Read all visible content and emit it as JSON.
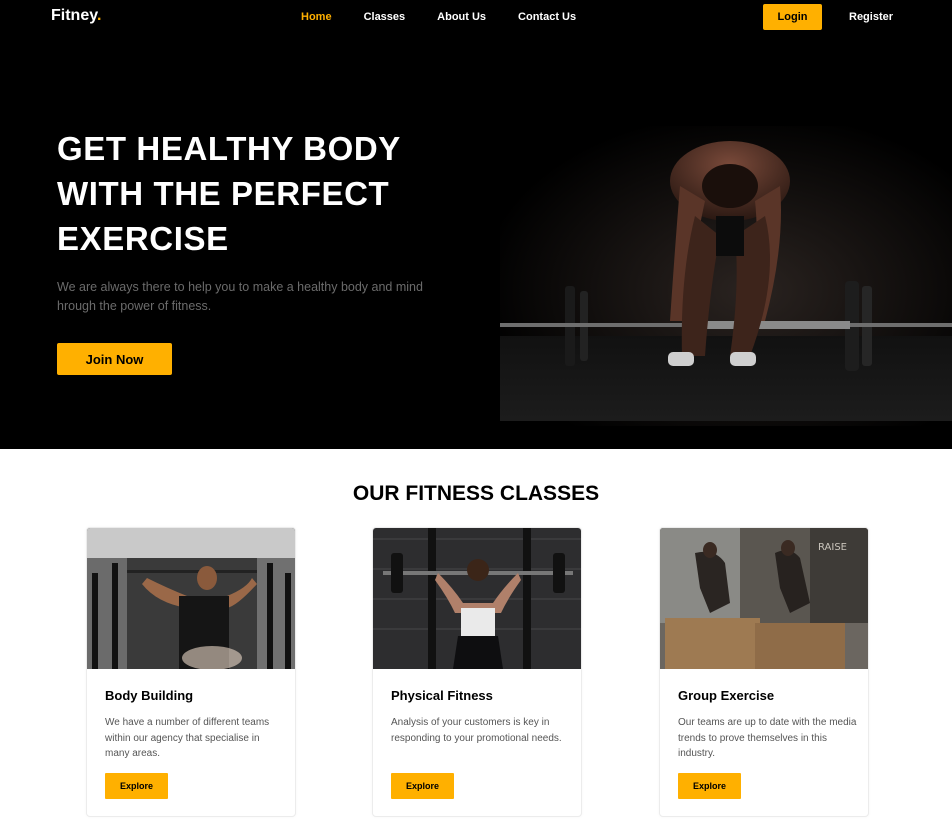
{
  "nav": {
    "logo": "Fitney",
    "logo_dot": ".",
    "items": [
      {
        "label": "Home",
        "active": true
      },
      {
        "label": "Classes",
        "active": false
      },
      {
        "label": "About Us",
        "active": false
      },
      {
        "label": "Contact Us",
        "active": false
      }
    ],
    "login_label": "Login",
    "register_label": "Register"
  },
  "hero": {
    "heading_line1": "GET HEALTHY BODY",
    "heading_line2": "WITH THE PERFECT",
    "heading_line3": "EXERCISE",
    "description": "We are always there to help you to make a healthy body and mind hrough the power of fitness.",
    "cta_label": "Join Now",
    "image_icon": "weightlifter-deadlift-photo"
  },
  "classes": {
    "title": "OUR FITNESS CLASSES",
    "cards": [
      {
        "title": "Body Building",
        "description": "We have a number of different teams within our agency that specialise in many areas.",
        "button": "Explore",
        "image_icon": "lat-pulldown-photo"
      },
      {
        "title": "Physical Fitness",
        "description": "Analysis of your customers is key in responding to your promotional needs.",
        "button": "Explore",
        "image_icon": "overhead-barbell-photo"
      },
      {
        "title": "Group Exercise",
        "description": "Our teams are up to date with the media trends to prove themselves in this industry.",
        "button": "Explore",
        "image_icon": "box-jump-photo",
        "wall_text": "RAISE THE BAR"
      }
    ]
  },
  "colors": {
    "accent": "#ffb000",
    "hero_bg": "#000000",
    "body_bg": "#ffffff"
  }
}
